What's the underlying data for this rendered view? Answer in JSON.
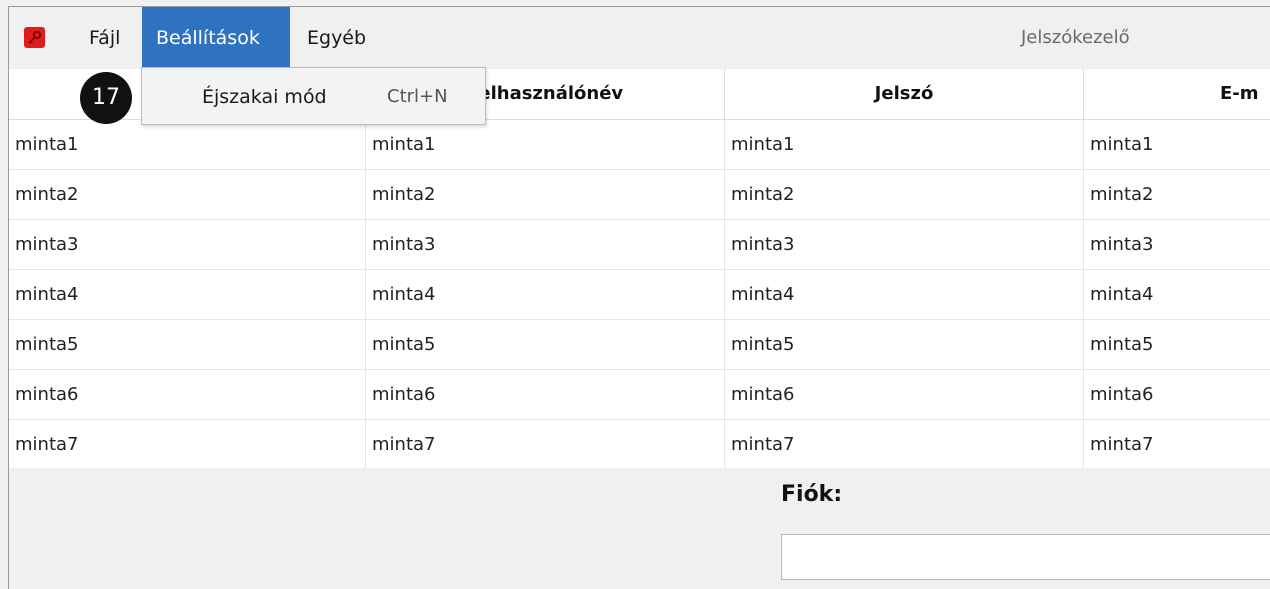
{
  "menubar": {
    "icon": "key-icon",
    "accent": "#e01b1b",
    "items": [
      {
        "label": "Fájl"
      },
      {
        "label": "Beállítások"
      },
      {
        "label": "Egyéb"
      }
    ],
    "active_color": "#2f73c0",
    "title": "Jelszókezelő"
  },
  "dropdown": {
    "item_label": "Éjszakai mód",
    "shortcut": "Ctrl+N"
  },
  "badge": "17",
  "table": {
    "columns": [
      "",
      "Felhasználónév",
      "Jelszó",
      "E-m"
    ],
    "rows": [
      [
        "minta1",
        "minta1",
        "minta1",
        "minta1"
      ],
      [
        "minta2",
        "minta2",
        "minta2",
        "minta2"
      ],
      [
        "minta3",
        "minta3",
        "minta3",
        "minta3"
      ],
      [
        "minta4",
        "minta4",
        "minta4",
        "minta4"
      ],
      [
        "minta5",
        "minta5",
        "minta5",
        "minta5"
      ],
      [
        "minta6",
        "minta6",
        "minta6",
        "minta6"
      ],
      [
        "minta7",
        "minta7",
        "minta7",
        "minta7"
      ]
    ]
  },
  "form": {
    "label": "Fiók:",
    "value": ""
  }
}
